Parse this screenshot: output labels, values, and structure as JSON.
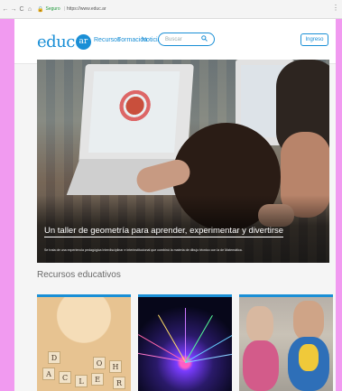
{
  "browser": {
    "back": "←",
    "forward": "→",
    "reload": "C",
    "home": "⌂",
    "lock": "🔒",
    "secure_label": "Seguro",
    "separator": "|",
    "url": "https://www.educ.ar",
    "menu": "⋮"
  },
  "header": {
    "logo_text": "educ",
    "logo_badge": "ar",
    "nav": [
      {
        "label": "Recursos"
      },
      {
        "label": "Formación"
      },
      {
        "label": "Noticias",
        "chevron": "⌄"
      }
    ],
    "search": {
      "placeholder": "Buscar",
      "icon": "search-icon"
    },
    "login_label": "Ingreso"
  },
  "hero": {
    "title": "Un taller de geometría para aprender, experimentar y divertirse",
    "subtitle": "Se trata de una experiencia pedagógica interdisciplinar e interinstitucional que combinó la materia de dibujo técnico con la de Matemática."
  },
  "resources": {
    "title": "Recursos educativos",
    "cards": [
      {
        "image": "letter-blocks",
        "blocks": [
          "A",
          "C",
          "L",
          "E",
          "O",
          "H",
          "R",
          "D"
        ]
      },
      {
        "image": "light-burst"
      },
      {
        "image": "children-costumes"
      }
    ]
  },
  "colors": {
    "accent": "#1a8fd6",
    "page_background": "#f19af0"
  }
}
